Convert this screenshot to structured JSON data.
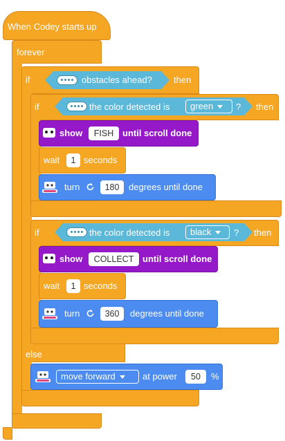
{
  "hat": {
    "label": "When Codey starts up"
  },
  "forever": {
    "label": "forever"
  },
  "if_outer": {
    "label": "if",
    "then_label": "then",
    "else_label": "else",
    "condition": {
      "label": "obstacles ahead?"
    }
  },
  "if_green": {
    "label": "if",
    "then_label": "then",
    "condition": {
      "prefix": "the color detected is",
      "color": "green",
      "suffix": "?"
    },
    "show": {
      "label": "show",
      "text": "FISH",
      "suffix": "until scroll done"
    },
    "wait": {
      "label": "wait",
      "value": "1",
      "suffix": "seconds"
    },
    "turn": {
      "label": "turn",
      "icon": "rotate-cw-icon",
      "value": "180",
      "suffix": "degrees until done"
    }
  },
  "if_black": {
    "label": "if",
    "then_label": "then",
    "condition": {
      "prefix": "the color detected is",
      "color": "black",
      "suffix": "?"
    },
    "show": {
      "label": "show",
      "text": "COLLECT",
      "suffix": "until scroll done"
    },
    "wait": {
      "label": "wait",
      "value": "1",
      "suffix": "seconds"
    },
    "turn": {
      "label": "turn",
      "icon": "rotate-cw-icon",
      "value": "360",
      "suffix": "degrees until done"
    }
  },
  "move": {
    "direction": "move forward",
    "label": "at power",
    "value": "50",
    "unit": "%"
  },
  "colors": {
    "control": "#F5A623",
    "looks": "#9619C9",
    "motion": "#4C8CF0",
    "sensing": "#5BB8D9"
  }
}
